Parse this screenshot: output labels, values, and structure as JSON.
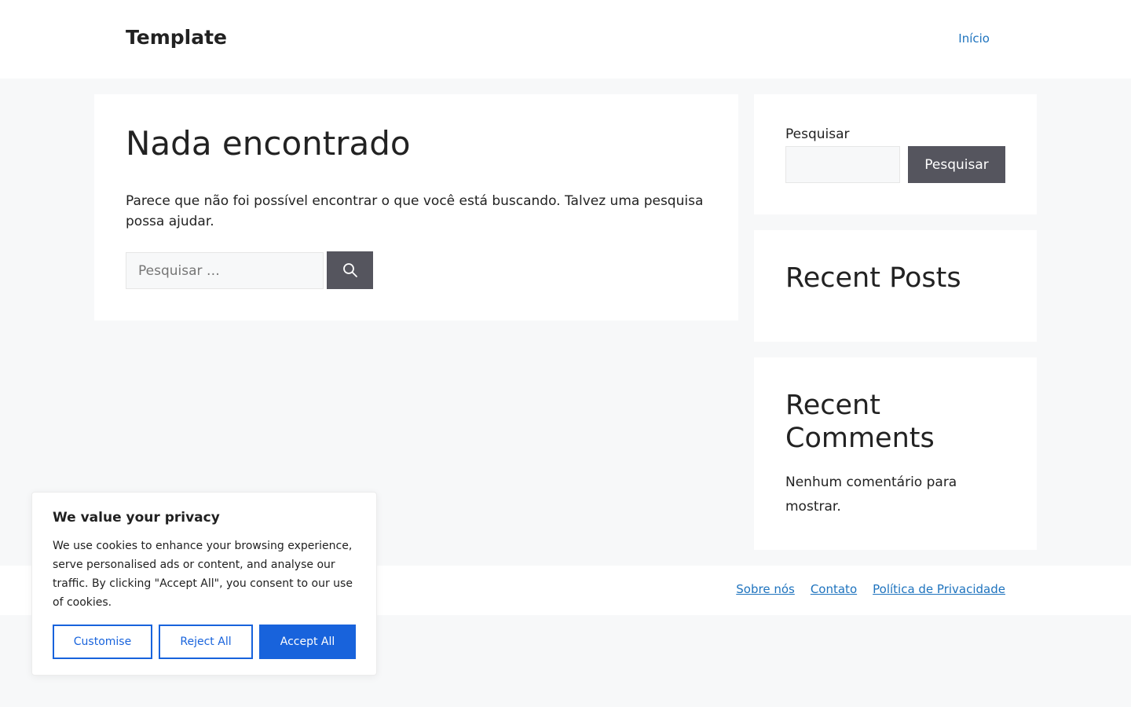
{
  "header": {
    "site_title": "Template",
    "nav": [
      {
        "label": "Início"
      }
    ]
  },
  "main": {
    "title": "Nada encontrado",
    "text": "Parece que não foi possível encontrar o que você está buscando. Talvez uma pesquisa possa ajudar.",
    "search_placeholder": "Pesquisar …",
    "search_icon": "search-icon"
  },
  "sidebar": {
    "search_widget": {
      "label": "Pesquisar",
      "button_label": "Pesquisar",
      "input_value": ""
    },
    "recent_posts": {
      "title": "Recent Posts"
    },
    "recent_comments": {
      "title": "Recent Comments",
      "text": "Nenhum comentário para mostrar."
    }
  },
  "footer": {
    "links": [
      {
        "label": "Sobre nós"
      },
      {
        "label": "Contato"
      },
      {
        "label": "Política de Privacidade"
      }
    ]
  },
  "cookie_banner": {
    "title": "We value your privacy",
    "text": "We use cookies to enhance your browsing experience, serve personalised ads or content, and analyse our traffic. By clicking \"Accept All\", you consent to our use of cookies.",
    "customise_label": "Customise",
    "reject_label": "Reject All",
    "accept_label": "Accept All"
  },
  "colors": {
    "link": "#1e73be",
    "button_dark": "#55555e",
    "cookie_accent": "#1863dc",
    "page_background": "#f7f8f9"
  }
}
